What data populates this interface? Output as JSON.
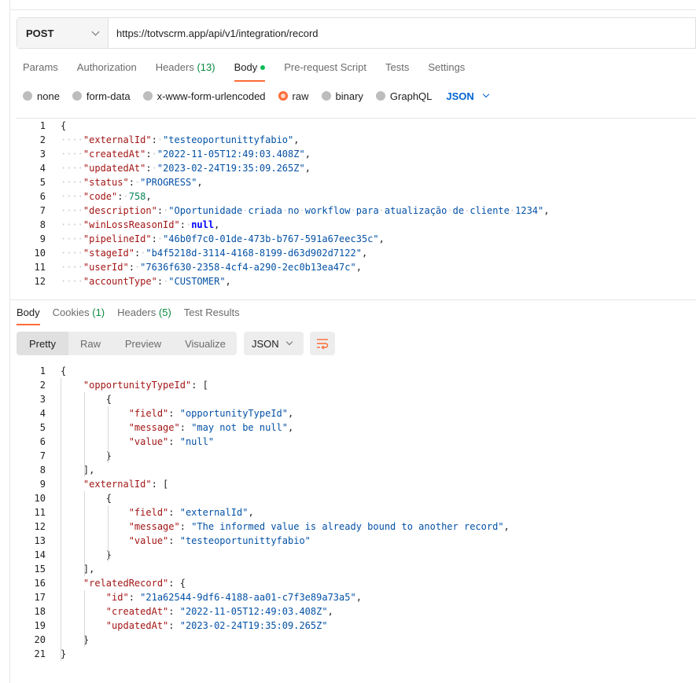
{
  "request": {
    "method": "POST",
    "url": "https://totvscrm.app/api/v1/integration/record",
    "tabs": [
      {
        "label": "Params"
      },
      {
        "label": "Authorization"
      },
      {
        "label": "Headers",
        "count": "(13)"
      },
      {
        "label": "Body"
      },
      {
        "label": "Pre-request Script"
      },
      {
        "label": "Tests"
      },
      {
        "label": "Settings"
      }
    ],
    "active_tab": "Body",
    "body_types": [
      "none",
      "form-data",
      "x-www-form-urlencoded",
      "raw",
      "binary",
      "GraphQL"
    ],
    "selected_body_type": "raw",
    "language": "JSON",
    "body_lines": [
      {
        "n": "1",
        "indent": 0,
        "parts": [
          [
            "p",
            "{"
          ]
        ]
      },
      {
        "n": "2",
        "indent": 1,
        "parts": [
          [
            "k",
            "\"externalId\""
          ],
          [
            "p",
            ": "
          ],
          [
            "s",
            "\"testeoportunittyfabio\""
          ],
          [
            "p",
            ","
          ]
        ]
      },
      {
        "n": "3",
        "indent": 1,
        "parts": [
          [
            "k",
            "\"createdAt\""
          ],
          [
            "p",
            ": "
          ],
          [
            "s",
            "\"2022-11-05T12:49:03.408Z\""
          ],
          [
            "p",
            ","
          ]
        ]
      },
      {
        "n": "4",
        "indent": 1,
        "parts": [
          [
            "k",
            "\"updatedAt\""
          ],
          [
            "p",
            ": "
          ],
          [
            "s",
            "\"2023-02-24T19:35:09.265Z\""
          ],
          [
            "p",
            ","
          ]
        ]
      },
      {
        "n": "5",
        "indent": 1,
        "parts": [
          [
            "k",
            "\"status\""
          ],
          [
            "p",
            ": "
          ],
          [
            "s",
            "\"PROGRESS\""
          ],
          [
            "p",
            ","
          ]
        ]
      },
      {
        "n": "6",
        "indent": 1,
        "parts": [
          [
            "k",
            "\"code\""
          ],
          [
            "p",
            ": "
          ],
          [
            "n",
            "758"
          ],
          [
            "p",
            ","
          ]
        ]
      },
      {
        "n": "7",
        "indent": 1,
        "parts": [
          [
            "k",
            "\"description\""
          ],
          [
            "p",
            ": "
          ],
          [
            "s",
            "\"Oportunidade criada no workflow para atualização de cliente 1234\""
          ],
          [
            "p",
            ","
          ]
        ]
      },
      {
        "n": "8",
        "indent": 1,
        "parts": [
          [
            "k",
            "\"winLossReasonId\""
          ],
          [
            "p",
            ": "
          ],
          [
            "b",
            "null"
          ],
          [
            "p",
            ","
          ]
        ]
      },
      {
        "n": "9",
        "indent": 1,
        "parts": [
          [
            "k",
            "\"pipelineId\""
          ],
          [
            "p",
            ": "
          ],
          [
            "s",
            "\"46b0f7c0-01de-473b-b767-591a67eec35c\""
          ],
          [
            "p",
            ","
          ]
        ]
      },
      {
        "n": "10",
        "indent": 1,
        "parts": [
          [
            "k",
            "\"stageId\""
          ],
          [
            "p",
            ": "
          ],
          [
            "s",
            "\"b4f5218d-3114-4168-8199-d63d902d7122\""
          ],
          [
            "p",
            ","
          ]
        ]
      },
      {
        "n": "11",
        "indent": 1,
        "parts": [
          [
            "k",
            "\"userId\""
          ],
          [
            "p",
            ": "
          ],
          [
            "s",
            "\"7636f630-2358-4cf4-a290-2ec0b13ea47c\""
          ],
          [
            "p",
            ","
          ]
        ]
      },
      {
        "n": "12",
        "indent": 1,
        "parts": [
          [
            "k",
            "\"accountType\""
          ],
          [
            "p",
            ": "
          ],
          [
            "s",
            "\"CUSTOMER\""
          ],
          [
            "p",
            ","
          ]
        ]
      }
    ]
  },
  "response": {
    "tabs": [
      {
        "label": "Body"
      },
      {
        "label": "Cookies",
        "count": "(1)"
      },
      {
        "label": "Headers",
        "count": "(5)"
      },
      {
        "label": "Test Results"
      }
    ],
    "active_tab": "Body",
    "views": [
      "Pretty",
      "Raw",
      "Preview",
      "Visualize"
    ],
    "active_view": "Pretty",
    "format": "JSON",
    "body_lines": [
      {
        "n": "1",
        "indent": 0,
        "parts": [
          [
            "p",
            "{"
          ]
        ]
      },
      {
        "n": "2",
        "indent": 1,
        "parts": [
          [
            "k",
            "\"opportunityTypeId\""
          ],
          [
            "p",
            ": ["
          ]
        ]
      },
      {
        "n": "3",
        "indent": 2,
        "parts": [
          [
            "p",
            "{"
          ]
        ]
      },
      {
        "n": "4",
        "indent": 3,
        "parts": [
          [
            "k",
            "\"field\""
          ],
          [
            "p",
            ": "
          ],
          [
            "s",
            "\"opportunityTypeId\""
          ],
          [
            "p",
            ","
          ]
        ]
      },
      {
        "n": "5",
        "indent": 3,
        "parts": [
          [
            "k",
            "\"message\""
          ],
          [
            "p",
            ": "
          ],
          [
            "s",
            "\"may not be null\""
          ],
          [
            "p",
            ","
          ]
        ]
      },
      {
        "n": "6",
        "indent": 3,
        "parts": [
          [
            "k",
            "\"value\""
          ],
          [
            "p",
            ": "
          ],
          [
            "s",
            "\"null\""
          ]
        ]
      },
      {
        "n": "7",
        "indent": 2,
        "parts": [
          [
            "p",
            "}"
          ]
        ]
      },
      {
        "n": "8",
        "indent": 1,
        "parts": [
          [
            "p",
            "],"
          ]
        ]
      },
      {
        "n": "9",
        "indent": 1,
        "parts": [
          [
            "k",
            "\"externalId\""
          ],
          [
            "p",
            ": ["
          ]
        ]
      },
      {
        "n": "10",
        "indent": 2,
        "parts": [
          [
            "p",
            "{"
          ]
        ]
      },
      {
        "n": "11",
        "indent": 3,
        "parts": [
          [
            "k",
            "\"field\""
          ],
          [
            "p",
            ": "
          ],
          [
            "s",
            "\"externalId\""
          ],
          [
            "p",
            ","
          ]
        ]
      },
      {
        "n": "12",
        "indent": 3,
        "parts": [
          [
            "k",
            "\"message\""
          ],
          [
            "p",
            ": "
          ],
          [
            "s",
            "\"The informed value is already bound to another record\""
          ],
          [
            "p",
            ","
          ]
        ]
      },
      {
        "n": "13",
        "indent": 3,
        "parts": [
          [
            "k",
            "\"value\""
          ],
          [
            "p",
            ": "
          ],
          [
            "s",
            "\"testeoportunittyfabio\""
          ]
        ]
      },
      {
        "n": "14",
        "indent": 2,
        "parts": [
          [
            "p",
            "}"
          ]
        ]
      },
      {
        "n": "15",
        "indent": 1,
        "parts": [
          [
            "p",
            "],"
          ]
        ]
      },
      {
        "n": "16",
        "indent": 1,
        "parts": [
          [
            "k",
            "\"relatedRecord\""
          ],
          [
            "p",
            ": {"
          ]
        ]
      },
      {
        "n": "17",
        "indent": 2,
        "parts": [
          [
            "k",
            "\"id\""
          ],
          [
            "p",
            ": "
          ],
          [
            "s",
            "\"21a62544-9df6-4188-aa01-c7f3e89a73a5\""
          ],
          [
            "p",
            ","
          ]
        ]
      },
      {
        "n": "18",
        "indent": 2,
        "parts": [
          [
            "k",
            "\"createdAt\""
          ],
          [
            "p",
            ": "
          ],
          [
            "s",
            "\"2022-11-05T12:49:03.408Z\""
          ],
          [
            "p",
            ","
          ]
        ]
      },
      {
        "n": "19",
        "indent": 2,
        "parts": [
          [
            "k",
            "\"updatedAt\""
          ],
          [
            "p",
            ": "
          ],
          [
            "s",
            "\"2023-02-24T19:35:09.265Z\""
          ]
        ]
      },
      {
        "n": "20",
        "indent": 1,
        "parts": [
          [
            "p",
            "}"
          ]
        ]
      },
      {
        "n": "21",
        "indent": 0,
        "parts": [
          [
            "p",
            "}"
          ]
        ]
      }
    ]
  },
  "icons": {
    "method_dropdown": "chevron-down-icon",
    "language_dropdown": "chevron-down-icon",
    "format_dropdown": "chevron-down-icon",
    "wrap": "wrap-lines-icon"
  },
  "colors": {
    "accent": "#ff6c37",
    "link_blue": "#0265d2",
    "count_green": "#0a8a3f",
    "json_key": "#a31515",
    "json_string": "#0451a5",
    "json_number": "#098658"
  }
}
